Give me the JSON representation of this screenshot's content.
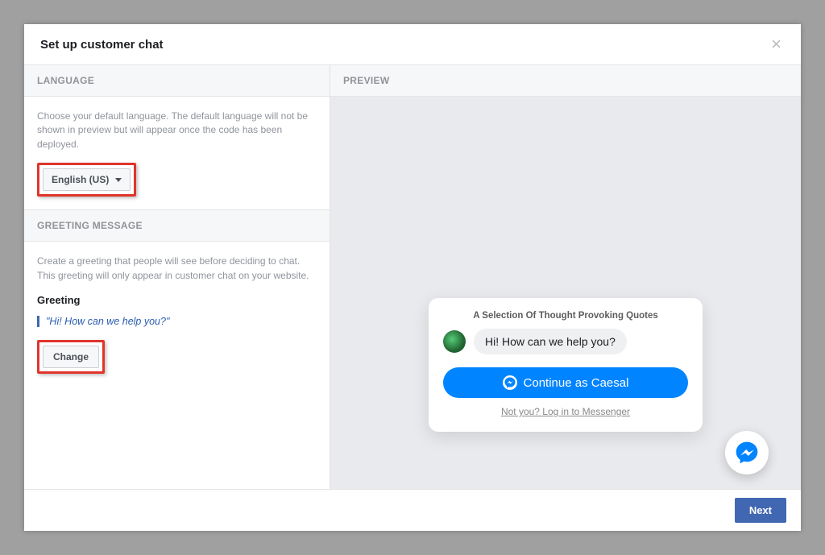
{
  "header": {
    "title": "Set up customer chat"
  },
  "language_section": {
    "heading": "LANGUAGE",
    "help_text": "Choose your default language. The default language will not be shown in preview but will appear once the code has been deployed.",
    "selected_language": "English (US)"
  },
  "greeting_section": {
    "heading": "GREETING MESSAGE",
    "help_text": "Create a greeting that people will see before deciding to chat. This greeting will only appear in customer chat on your website.",
    "label": "Greeting",
    "greeting_text": "\"Hi! How can we help you?\"",
    "change_label": "Change"
  },
  "preview": {
    "heading": "PREVIEW",
    "chat_title": "A Selection Of Thought Provoking Quotes",
    "chat_bubble_text": "Hi! How can we help you?",
    "continue_label": "Continue as Caesal",
    "not_you_label": "Not you? Log in to Messenger"
  },
  "footer": {
    "next_label": "Next"
  },
  "colors": {
    "accent": "#4267b2",
    "messenger_blue": "#0084ff",
    "highlight_red": "#e0342b"
  }
}
